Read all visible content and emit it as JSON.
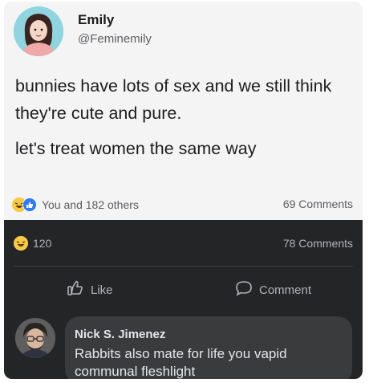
{
  "post": {
    "author_name": "Emily",
    "author_handle": "@Feminemily",
    "text_line_1": "bunnies have lots of sex and we still think they're cute and pure.",
    "text_line_2": "let's treat women the same way",
    "reactions_text": "You and 182 others",
    "comments_text": "69 Comments"
  },
  "share": {
    "reaction_count": "120",
    "comments_text": "78 Comments",
    "like_label": "Like",
    "comment_label": "Comment"
  },
  "comment": {
    "author": "Nick S. Jimenez",
    "text": "Rabbits also mate for life you vapid communal fleshlight"
  },
  "icons": [
    "haha-emoji-icon",
    "like-emoji-icon",
    "thumbs-up-icon",
    "comment-bubble-icon"
  ],
  "colors": {
    "dark_bg": "#242526",
    "bubble_bg": "#3a3b3c",
    "like_blue": "#2f7df6",
    "haha_yellow": "#f7c948"
  }
}
